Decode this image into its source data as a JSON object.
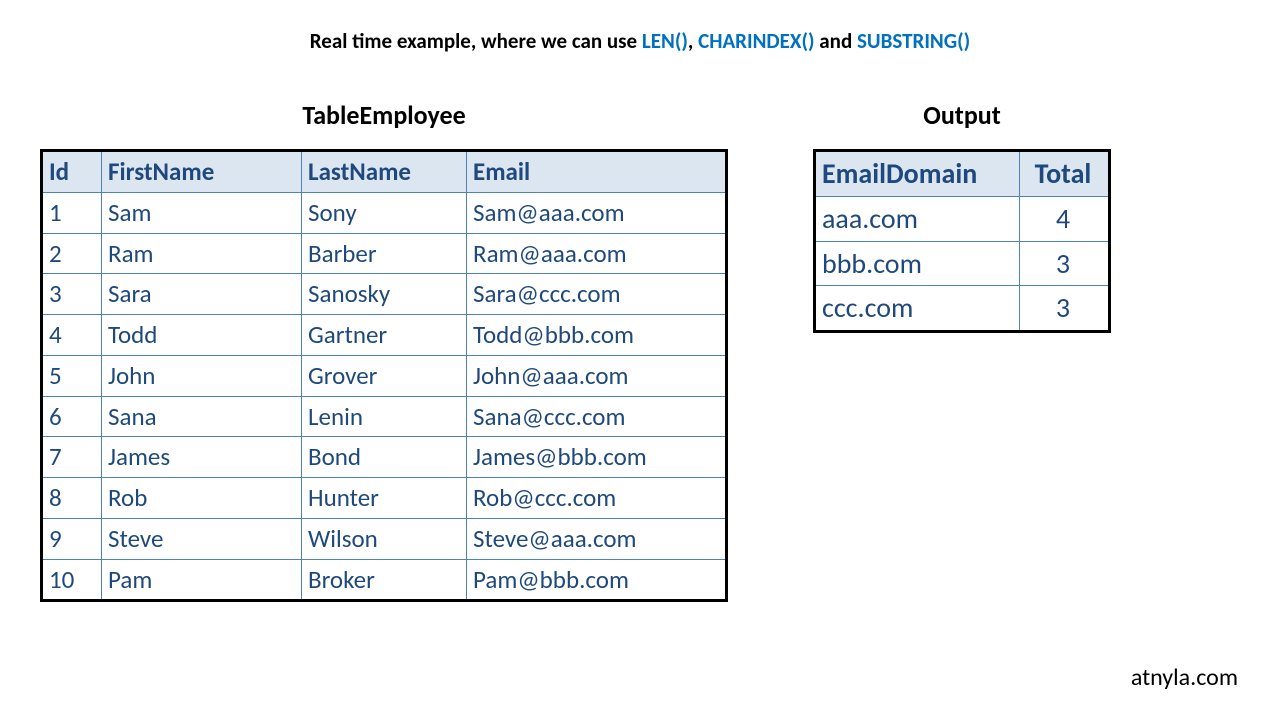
{
  "header": {
    "part1": "Real time example, where we can use ",
    "fn1": "LEN()",
    "sep1": ", ",
    "fn2": "CHARINDEX()",
    "sep2": " and ",
    "fn3": "SUBSTRING()"
  },
  "employee": {
    "title": "TableEmployee",
    "columns": {
      "c0": "Id",
      "c1": "FirstName",
      "c2": "LastName",
      "c3": "Email"
    },
    "rows": [
      {
        "id": "1",
        "first": "Sam",
        "last": "Sony",
        "email": "Sam@aaa.com"
      },
      {
        "id": "2",
        "first": "Ram",
        "last": "Barber",
        "email": "Ram@aaa.com"
      },
      {
        "id": "3",
        "first": "Sara",
        "last": "Sanosky",
        "email": "Sara@ccc.com"
      },
      {
        "id": "4",
        "first": "Todd",
        "last": "Gartner",
        "email": "Todd@bbb.com"
      },
      {
        "id": "5",
        "first": "John",
        "last": "Grover",
        "email": "John@aaa.com"
      },
      {
        "id": "6",
        "first": "Sana",
        "last": "Lenin",
        "email": "Sana@ccc.com"
      },
      {
        "id": "7",
        "first": "James",
        "last": "Bond",
        "email": "James@bbb.com"
      },
      {
        "id": "8",
        "first": "Rob",
        "last": "Hunter",
        "email": "Rob@ccc.com"
      },
      {
        "id": "9",
        "first": "Steve",
        "last": "Wilson",
        "email": "Steve@aaa.com"
      },
      {
        "id": "10",
        "first": "Pam",
        "last": "Broker",
        "email": "Pam@bbb.com"
      }
    ]
  },
  "output": {
    "title": "Output",
    "columns": {
      "c0": "EmailDomain",
      "c1": "Total"
    },
    "rows": [
      {
        "domain": "aaa.com",
        "total": "4"
      },
      {
        "domain": "bbb.com",
        "total": "3"
      },
      {
        "domain": "ccc.com",
        "total": "3"
      }
    ]
  },
  "footer": "atnyla.com"
}
